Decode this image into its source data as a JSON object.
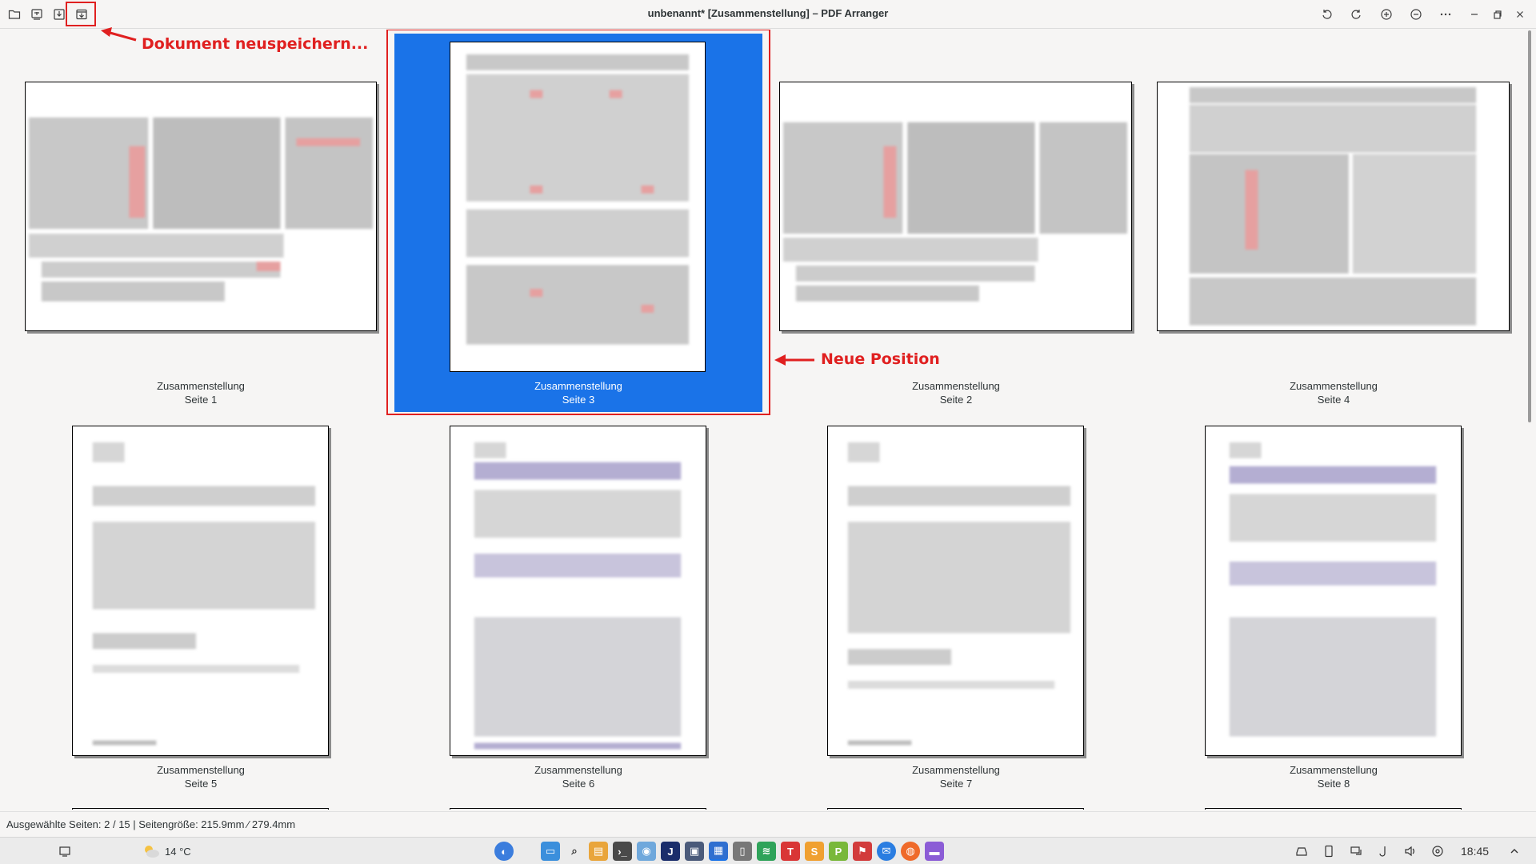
{
  "window": {
    "title": "unbenannt* [Zusammenstellung] – PDF Arranger"
  },
  "annotations": {
    "save_as": "Dokument neuspeichern...",
    "new_position": "Neue Position"
  },
  "pages": [
    {
      "doc": "Zusammenstellung",
      "label": "Seite 1",
      "selected": false,
      "orientation": "landscape"
    },
    {
      "doc": "Zusammenstellung",
      "label": "Seite 3",
      "selected": true,
      "orientation": "portrait"
    },
    {
      "doc": "Zusammenstellung",
      "label": "Seite 2",
      "selected": false,
      "orientation": "landscape"
    },
    {
      "doc": "Zusammenstellung",
      "label": "Seite 4",
      "selected": false,
      "orientation": "landscape"
    },
    {
      "doc": "Zusammenstellung",
      "label": "Seite 5",
      "selected": false,
      "orientation": "portrait"
    },
    {
      "doc": "Zusammenstellung",
      "label": "Seite 6",
      "selected": false,
      "orientation": "portrait"
    },
    {
      "doc": "Zusammenstellung",
      "label": "Seite 7",
      "selected": false,
      "orientation": "portrait"
    },
    {
      "doc": "Zusammenstellung",
      "label": "Seite 8",
      "selected": false,
      "orientation": "portrait"
    }
  ],
  "statusbar": {
    "text": "Ausgewählte Seiten: 2 / 15 | Seitengröße: 215.9mm ⁄ 279.4mm"
  },
  "taskbar": {
    "weather": "14 °C",
    "clock": "18:45"
  },
  "colors": {
    "selection": "#1a73e8",
    "annotation": "#e02020"
  }
}
